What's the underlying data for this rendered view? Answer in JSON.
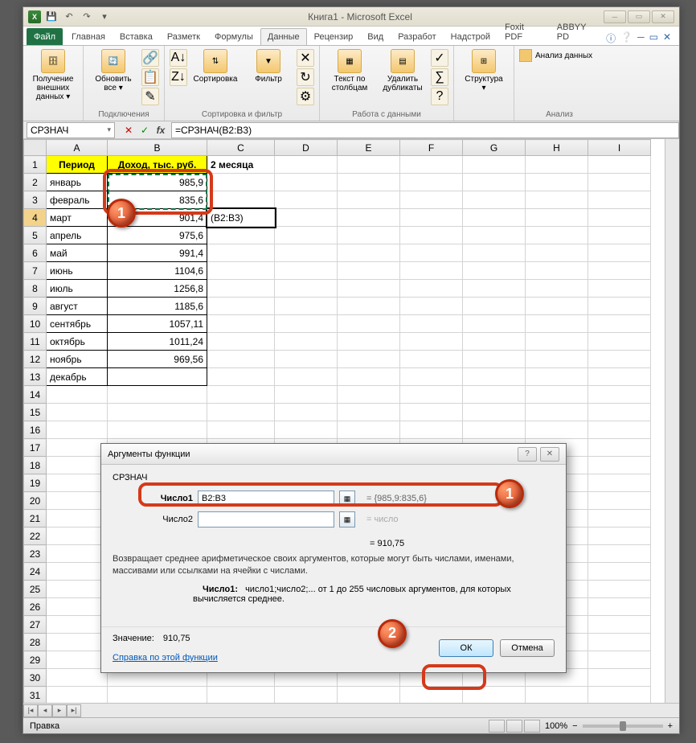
{
  "title": "Книга1  -  Microsoft Excel",
  "qat": {
    "save": "💾",
    "undo": "↶",
    "redo": "↷"
  },
  "tabs": {
    "file": "Файл",
    "items": [
      "Главная",
      "Вставка",
      "Разметк",
      "Формулы",
      "Данные",
      "Рецензир",
      "Вид",
      "Разработ",
      "Надстрой",
      "Foxit PDF",
      "ABBYY PD"
    ],
    "active_index": 4
  },
  "ribbon": {
    "groups": [
      {
        "label": "",
        "big": [
          {
            "name": "ext-data",
            "label": "Получение\nвнешних данных ▾"
          }
        ]
      },
      {
        "label": "Подключения",
        "big": [
          {
            "name": "refresh",
            "label": "Обновить\nвсе ▾"
          }
        ]
      },
      {
        "label": "Сортировка и фильтр",
        "big": [
          {
            "name": "sort",
            "label": "Сортировка"
          },
          {
            "name": "filter",
            "label": "Фильтр"
          }
        ]
      },
      {
        "label": "Работа с данными",
        "big": [
          {
            "name": "text-to-columns",
            "label": "Текст по\nстолбцам"
          },
          {
            "name": "remove-dupes",
            "label": "Удалить\nдубликаты"
          }
        ]
      },
      {
        "label": "",
        "big": [
          {
            "name": "structure",
            "label": "Структура\n▾"
          }
        ]
      },
      {
        "label": "Анализ",
        "big": [
          {
            "name": "data-analysis",
            "label": "Анализ данных"
          }
        ]
      }
    ]
  },
  "namebox": "СРЗНАЧ",
  "formula": "=СРЗНАЧ(B2:B3)",
  "columns": [
    "A",
    "B",
    "C",
    "D",
    "E",
    "F",
    "G",
    "H",
    "I"
  ],
  "grid": {
    "headers": {
      "period": "Период",
      "income": "Доход, тыс. руб.",
      "c1": "2 месяца"
    },
    "rows": [
      {
        "r": 2,
        "period": "январь",
        "value": "985,9"
      },
      {
        "r": 3,
        "period": "февраль",
        "value": "835,6"
      },
      {
        "r": 4,
        "period": "март",
        "value": "901,4",
        "c": "(B2:B3)"
      },
      {
        "r": 5,
        "period": "апрель",
        "value": "975,6"
      },
      {
        "r": 6,
        "period": "май",
        "value": "991,4"
      },
      {
        "r": 7,
        "period": "июнь",
        "value": "1104,6"
      },
      {
        "r": 8,
        "period": "июль",
        "value": "1256,8"
      },
      {
        "r": 9,
        "period": "август",
        "value": "1185,6"
      },
      {
        "r": 10,
        "period": "сентябрь",
        "value": "1057,11"
      },
      {
        "r": 11,
        "period": "октябрь",
        "value": "1011,24"
      },
      {
        "r": 12,
        "period": "ноябрь",
        "value": "969,56"
      },
      {
        "r": 13,
        "period": "декабрь",
        "value": ""
      }
    ],
    "blank_rows": [
      14,
      15,
      16,
      17,
      18,
      19,
      20,
      21,
      22,
      23,
      24,
      25,
      26,
      27,
      28,
      29,
      30,
      31
    ]
  },
  "dialog": {
    "title": "Аргументы функции",
    "func": "СРЗНАЧ",
    "args": [
      {
        "label": "Число1",
        "value": "B2:B3",
        "result": "= {985,9:835,6}",
        "bold": true
      },
      {
        "label": "Число2",
        "value": "",
        "result": "= число",
        "bold": false
      }
    ],
    "calc": "= 910,75",
    "desc": "Возвращает среднее арифметическое своих аргументов, которые могут быть числами, именами, массивами или ссылками на ячейки с числами.",
    "arg_name": "Число1:",
    "arg_desc": "число1;число2;... от 1 до 255 числовых аргументов, для которых вычисляется среднее.",
    "value_label": "Значение:",
    "value": "910,75",
    "help": "Справка по этой функции",
    "ok": "ОК",
    "cancel": "Отмена"
  },
  "status": {
    "mode": "Правка",
    "zoom": "100%"
  },
  "badges": {
    "one": "1",
    "two": "2"
  }
}
